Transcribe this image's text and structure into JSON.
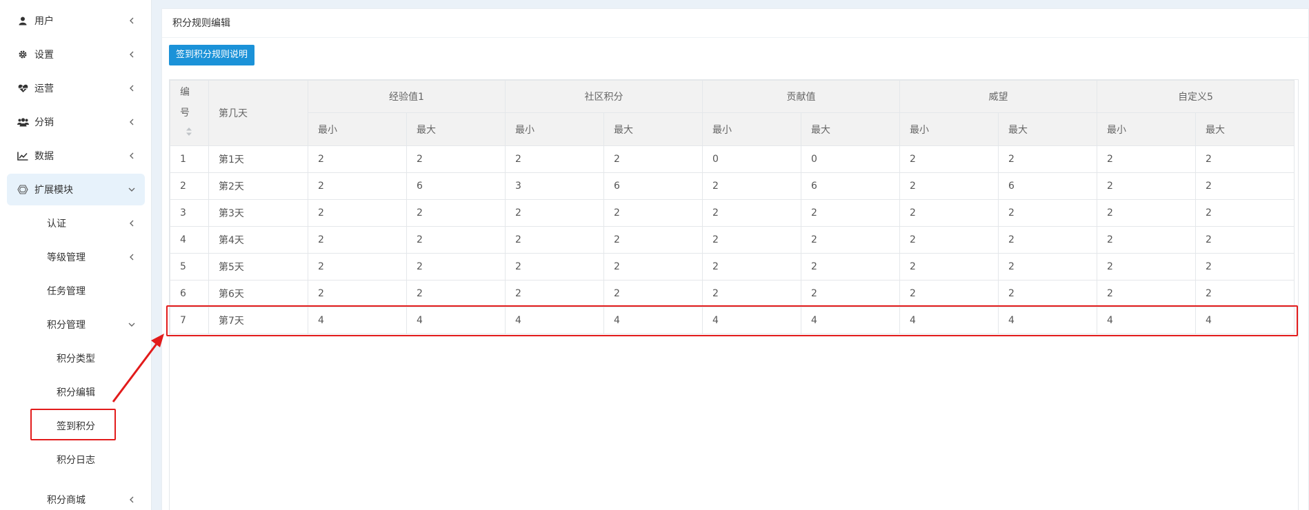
{
  "sidebar": {
    "items": [
      {
        "label": "用户",
        "icon": "user-icon"
      },
      {
        "label": "设置",
        "icon": "gear-icon"
      },
      {
        "label": "运营",
        "icon": "heartbeat-icon"
      },
      {
        "label": "分销",
        "icon": "users-icon"
      },
      {
        "label": "数据",
        "icon": "line-chart-icon"
      },
      {
        "label": "扩展模块",
        "icon": "cube-icon"
      }
    ],
    "submenu": [
      {
        "label": "认证"
      },
      {
        "label": "等级管理"
      },
      {
        "label": "任务管理"
      },
      {
        "label": "积分管理"
      }
    ],
    "points_children": [
      {
        "label": "积分类型"
      },
      {
        "label": "积分编辑"
      },
      {
        "label": "签到积分"
      },
      {
        "label": "积分日志"
      }
    ],
    "bottom_item": {
      "label": "积分商城"
    }
  },
  "panel": {
    "title": "积分规则编辑",
    "rules_button": "签到积分规则说明"
  },
  "table": {
    "id_header": [
      "编",
      "号"
    ],
    "day_header": "第几天",
    "groups": [
      "经验值1",
      "社区积分",
      "贡献值",
      "威望",
      "自定义5"
    ],
    "min_label": "最小",
    "max_label": "最大",
    "rows": [
      {
        "id": "1",
        "day": "第1天",
        "values": [
          "2",
          "2",
          "2",
          "2",
          "0",
          "0",
          "2",
          "2",
          "2",
          "2"
        ]
      },
      {
        "id": "2",
        "day": "第2天",
        "values": [
          "2",
          "6",
          "3",
          "6",
          "2",
          "6",
          "2",
          "6",
          "2",
          "2"
        ]
      },
      {
        "id": "3",
        "day": "第3天",
        "values": [
          "2",
          "2",
          "2",
          "2",
          "2",
          "2",
          "2",
          "2",
          "2",
          "2"
        ]
      },
      {
        "id": "4",
        "day": "第4天",
        "values": [
          "2",
          "2",
          "2",
          "2",
          "2",
          "2",
          "2",
          "2",
          "2",
          "2"
        ]
      },
      {
        "id": "5",
        "day": "第5天",
        "values": [
          "2",
          "2",
          "2",
          "2",
          "2",
          "2",
          "2",
          "2",
          "2",
          "2"
        ]
      },
      {
        "id": "6",
        "day": "第6天",
        "values": [
          "2",
          "2",
          "2",
          "2",
          "2",
          "2",
          "2",
          "2",
          "2",
          "2"
        ]
      },
      {
        "id": "7",
        "day": "第7天",
        "values": [
          "4",
          "4",
          "4",
          "4",
          "4",
          "4",
          "4",
          "4",
          "4",
          "4"
        ]
      }
    ]
  },
  "colors": {
    "accent": "#1b92d8",
    "highlight": "#e21b1b",
    "active_bg": "#e7f2fb"
  }
}
